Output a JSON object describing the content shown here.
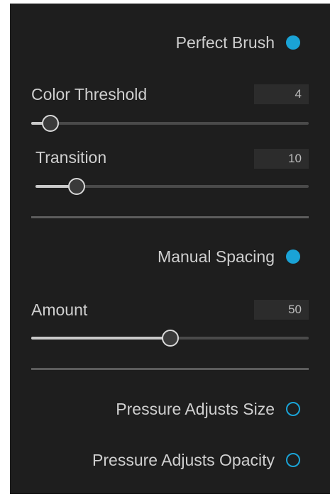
{
  "perfect_brush": {
    "label": "Perfect Brush",
    "enabled": true
  },
  "color_threshold": {
    "label": "Color Threshold",
    "value": "4",
    "level": 0.07
  },
  "transition": {
    "label": "Transition",
    "value": "10",
    "level": 0.15
  },
  "manual_spacing": {
    "label": "Manual Spacing",
    "enabled": true
  },
  "amount": {
    "label": "Amount",
    "value": "50",
    "level": 0.5
  },
  "pressure_size": {
    "label": "Pressure Adjusts Size",
    "enabled": false
  },
  "pressure_opacity": {
    "label": "Pressure Adjusts Opacity",
    "enabled": false
  },
  "colors": {
    "accent": "#1aa3d6",
    "panel": "#1e1e1e",
    "track": "#4a4a4a",
    "fill": "#c9c9c9"
  }
}
